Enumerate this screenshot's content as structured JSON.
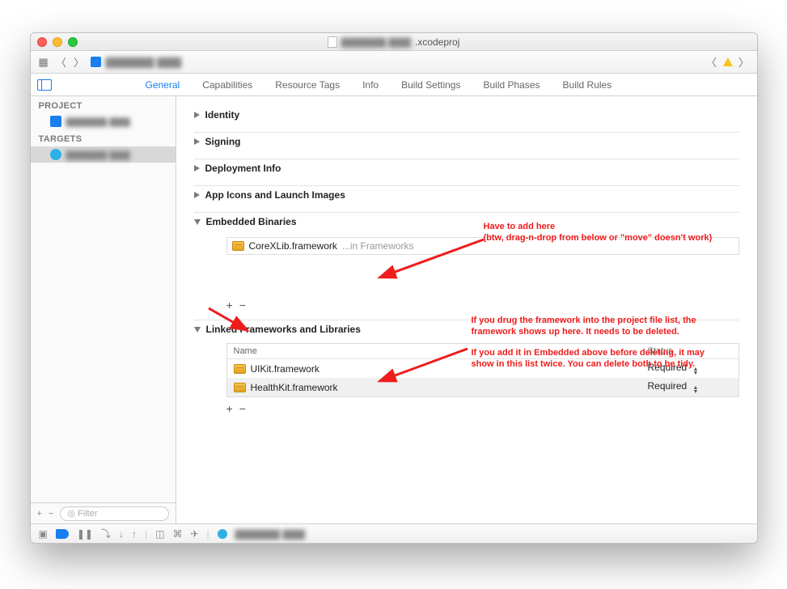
{
  "title_prefix": "▇▇▇▇▇▇ ▇▇▇",
  "title_suffix": ".xcodeproj",
  "breadcrumb_item": "▇▇▇▇▇▇ ▇▇▇",
  "tabs": {
    "general": "General",
    "capabilities": "Capabilities",
    "resource_tags": "Resource Tags",
    "info": "Info",
    "build_settings": "Build Settings",
    "build_phases": "Build Phases",
    "build_rules": "Build Rules"
  },
  "sidebar": {
    "project_label": "PROJECT",
    "project_name": "▇▇▇▇▇▇ ▇▇▇",
    "targets_label": "TARGETS",
    "target_name": "▇▇▇▇▇▇ ▇▇▇",
    "filter_placeholder": "Filter"
  },
  "sections": {
    "identity": "Identity",
    "signing": "Signing",
    "deployment": "Deployment Info",
    "appicons": "App Icons and Launch Images",
    "embedded": "Embedded Binaries",
    "linked": "Linked Frameworks and Libraries"
  },
  "embedded_rows": [
    {
      "name": "CoreXLib.framework",
      "path": "...in Frameworks"
    }
  ],
  "linked": {
    "col_name": "Name",
    "col_status": "Status",
    "rows": [
      {
        "name": "UIKit.framework",
        "status": "Required"
      },
      {
        "name": "HealthKit.framework",
        "status": "Required"
      }
    ]
  },
  "buttons": {
    "plus": "+",
    "minus": "−"
  },
  "annotations": {
    "a1_l1": "Have to add here",
    "a1_l2": "(btw, drag-n-drop from below or \"move\" doesn't work)",
    "a2_l1": "If you drug the framework into the project file list, the",
    "a2_l2": "framework shows up here. It needs to be deleted.",
    "a3_l1": "If you add it in Embedded above before deleting, it may",
    "a3_l2": "show in this list twice. You can delete both to be tidy."
  },
  "debug_label": "▇▇▇▇▇▇ ▇▇▇"
}
